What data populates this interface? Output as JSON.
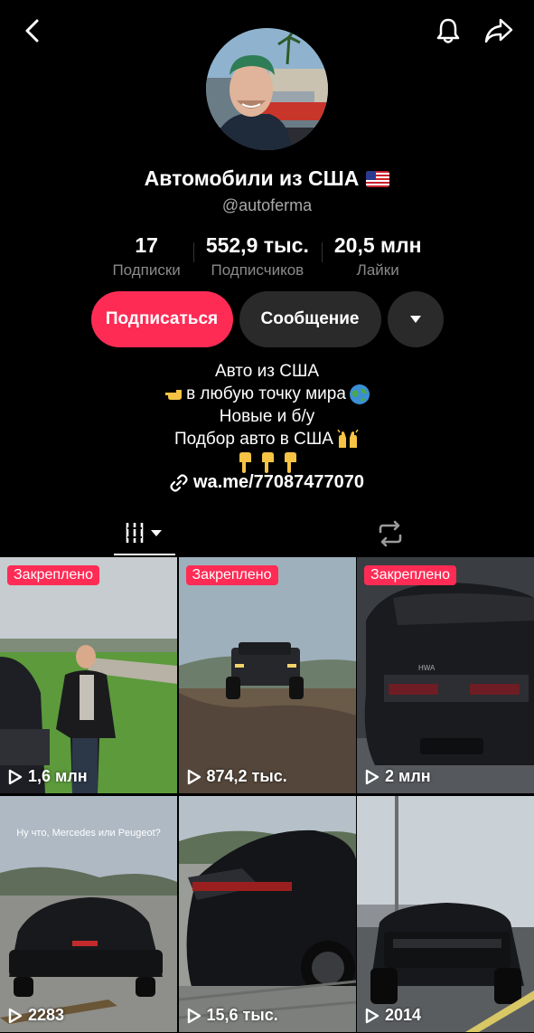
{
  "profile": {
    "display_name": "Автомобили из США",
    "username": "@autoferma"
  },
  "stats": [
    {
      "value": "17",
      "label": "Подписки"
    },
    {
      "value": "552,9 тыс.",
      "label": "Подписчиков"
    },
    {
      "value": "20,5 млн",
      "label": "Лайки"
    }
  ],
  "buttons": {
    "subscribe": "Подписаться",
    "message": "Сообщение"
  },
  "bio": {
    "line1": "Авто из США",
    "line2": "в любую точку мира",
    "line3": "Новые и б/у",
    "line4": "Подбор авто в США",
    "link": "wa.me/77087477070"
  },
  "videos": [
    {
      "pinned": "Закреплено",
      "views": "1,6 млн"
    },
    {
      "pinned": "Закреплено",
      "views": "874,2 тыс."
    },
    {
      "pinned": "Закреплено",
      "views": "2 млн"
    },
    {
      "views": "2283",
      "overlay": "Ну что, Mercedes или Peugeot?"
    },
    {
      "views": "15,6 тыс."
    },
    {
      "views": "2014"
    }
  ],
  "icons": {
    "back": "chevron-left-icon",
    "notifications": "bell-icon",
    "share": "share-arrow-icon",
    "more": "caret-down-icon",
    "link": "link-icon",
    "grid_tab": "grid-icon",
    "repost_tab": "repost-icon",
    "play": "play-icon"
  },
  "colors": {
    "accent": "#fe2c55",
    "background": "#000000",
    "secondary_button": "#2a2a2a",
    "muted_text": "#8a8a8a"
  }
}
